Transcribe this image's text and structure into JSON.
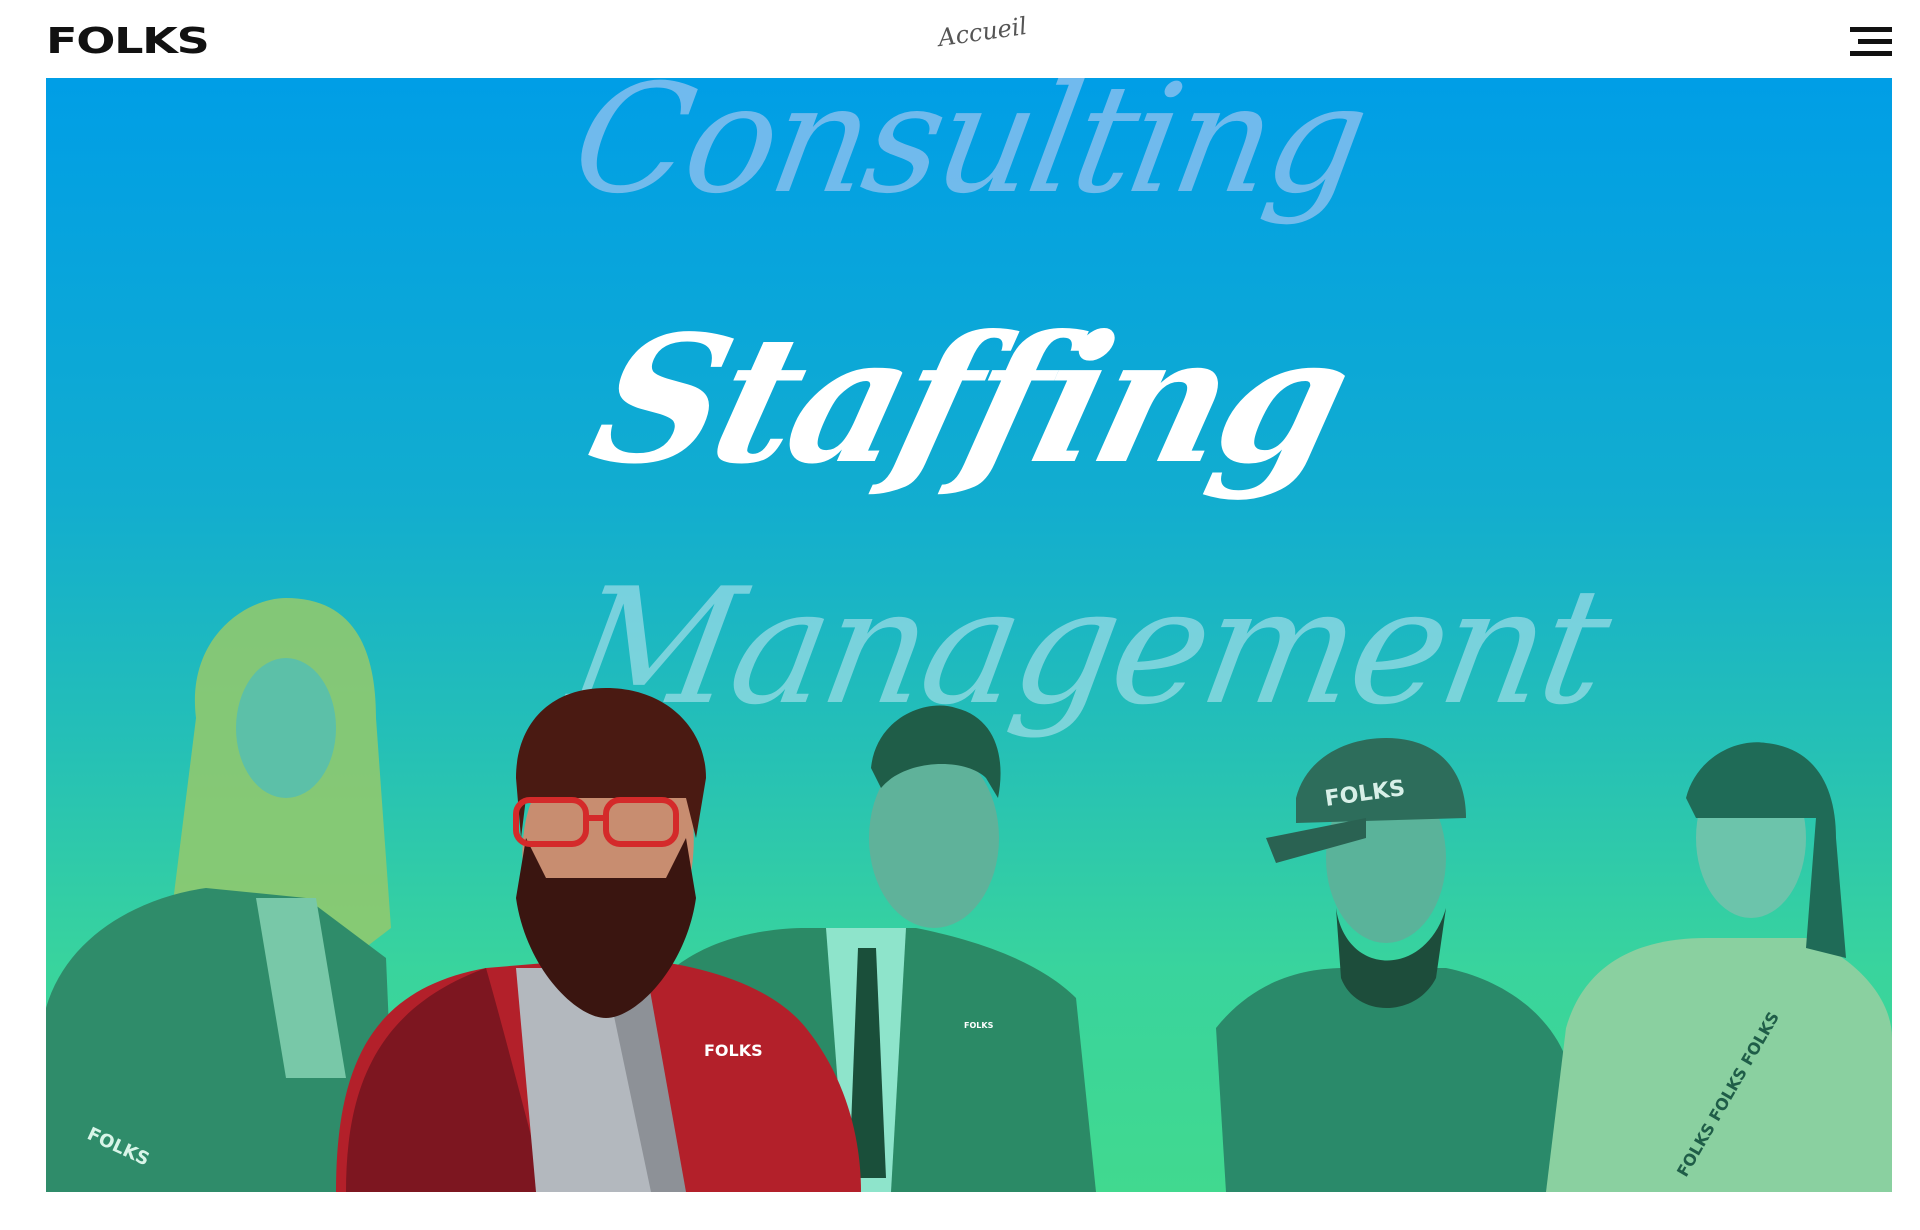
{
  "header": {
    "logo": "FOLKS",
    "nav_home": "Accueil",
    "menu_icon": "hamburger-menu-icon"
  },
  "hero": {
    "words": [
      "Consulting",
      "Staffing",
      "Management"
    ],
    "active_word_index": 1,
    "badges": [
      "FOLKS",
      "FOLKS",
      "FOLKS",
      "FOLKS",
      "FOLKS FOLKS FOLKS"
    ],
    "colors": {
      "gradient_top": "#009ee6",
      "gradient_bottom": "#41d98f",
      "jacket_red": "#b3202a",
      "white": "#ffffff"
    }
  }
}
